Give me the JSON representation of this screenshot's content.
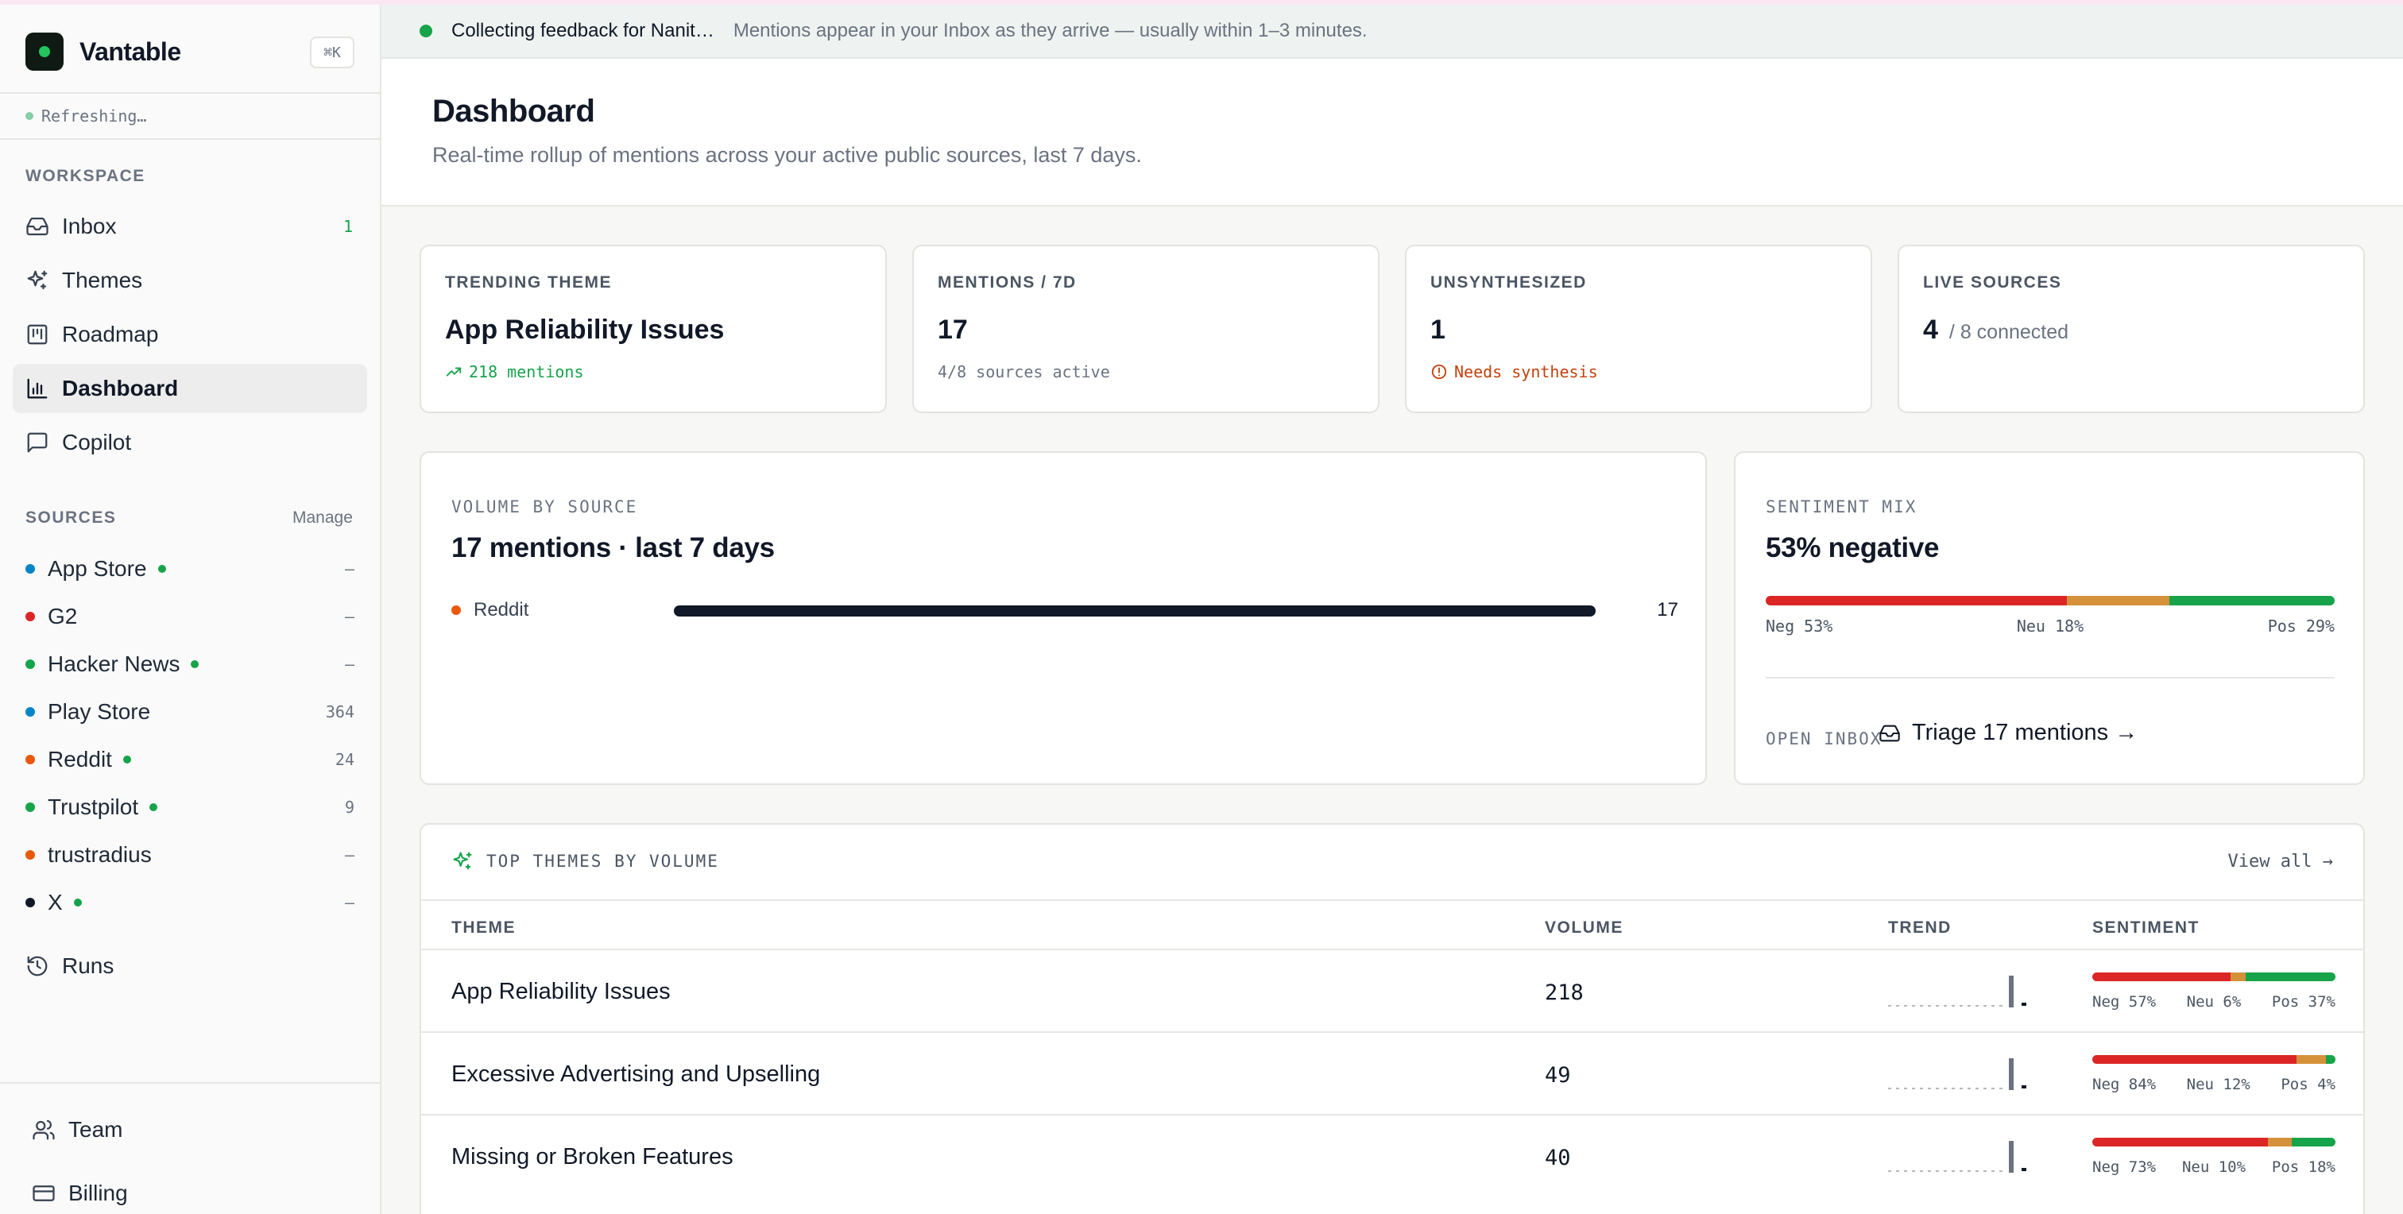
{
  "app": {
    "name": "Vantable",
    "shortcut": "⌘K",
    "status": "Refreshing…"
  },
  "sidebar": {
    "workspace_label": "WORKSPACE",
    "nav": [
      {
        "label": "Inbox",
        "icon": "inbox-icon",
        "badge": "1"
      },
      {
        "label": "Themes",
        "icon": "sparkles-icon",
        "badge": ""
      },
      {
        "label": "Roadmap",
        "icon": "roadmap-icon",
        "badge": ""
      },
      {
        "label": "Dashboard",
        "icon": "bar-chart-icon",
        "badge": "",
        "active": true
      },
      {
        "label": "Copilot",
        "icon": "chat-icon",
        "badge": ""
      }
    ],
    "sources_label": "SOURCES",
    "manage_label": "Manage",
    "sources": [
      {
        "name": "App Store",
        "color": "#0284c7",
        "live": true,
        "count": "–"
      },
      {
        "name": "G2",
        "color": "#dc2626",
        "live": false,
        "count": "–"
      },
      {
        "name": "Hacker News",
        "color": "#16a34a",
        "live": true,
        "count": "–"
      },
      {
        "name": "Play Store",
        "color": "#0284c7",
        "live": false,
        "count": "364"
      },
      {
        "name": "Reddit",
        "color": "#ea580c",
        "live": true,
        "count": "24"
      },
      {
        "name": "Trustpilot",
        "color": "#16a34a",
        "live": true,
        "count": "9"
      },
      {
        "name": "trustradius",
        "color": "#ea580c",
        "live": false,
        "count": "–"
      },
      {
        "name": "X",
        "color": "#111827",
        "live": true,
        "count": "–"
      }
    ],
    "runs_label": "Runs",
    "team_label": "Team",
    "billing_label": "Billing"
  },
  "banner": {
    "title": "Collecting feedback for Nanit…",
    "subtitle": "Mentions appear in your Inbox as they arrive — usually within 1–3 minutes."
  },
  "header": {
    "title": "Dashboard",
    "subtitle": "Real-time rollup of mentions across your active public sources, last 7 days."
  },
  "kpis": {
    "trending": {
      "label": "TRENDING THEME",
      "value": "App Reliability Issues",
      "sub": "218 mentions"
    },
    "mentions": {
      "label": "MENTIONS / 7D",
      "value": "17",
      "sub": "4/8 sources active"
    },
    "unsynth": {
      "label": "UNSYNTHESIZED",
      "value": "1",
      "sub": "Needs synthesis"
    },
    "live": {
      "label": "LIVE SOURCES",
      "value": "4",
      "suffix": "/ 8 connected"
    }
  },
  "volume": {
    "label": "VOLUME BY SOURCE",
    "title": "17 mentions · last 7 days",
    "rows": [
      {
        "name": "Reddit",
        "color": "#ea580c",
        "value": 17,
        "max": 17,
        "value_label": "17"
      }
    ]
  },
  "sentiment": {
    "label": "SENTIMENT MIX",
    "title": "53% negative",
    "neg": 53,
    "neu": 18,
    "pos": 29,
    "neg_label": "Neg 53%",
    "neu_label": "Neu 18%",
    "pos_label": "Pos 29%",
    "open_label": "OPEN INBOX",
    "triage_label": "Triage 17 mentions →"
  },
  "themes": {
    "label": "TOP THEMES BY VOLUME",
    "view_all": "View all →",
    "columns": {
      "theme": "THEME",
      "volume": "VOLUME",
      "trend": "TREND",
      "sentiment": "SENTIMENT"
    },
    "rows": [
      {
        "name": "App Reliability Issues",
        "volume": "218",
        "neg": 57,
        "neu": 6,
        "pos": 37,
        "neg_label": "Neg 57%",
        "neu_label": "Neu 6%",
        "pos_label": "Pos 37%"
      },
      {
        "name": "Excessive Advertising and Upselling",
        "volume": "49",
        "neg": 84,
        "neu": 12,
        "pos": 4,
        "neg_label": "Neg 84%",
        "neu_label": "Neu 12%",
        "pos_label": "Pos 4%"
      },
      {
        "name": "Missing or Broken Features",
        "volume": "40",
        "neg": 73,
        "neu": 10,
        "pos": 18,
        "neg_label": "Neg 73%",
        "neu_label": "Neu 10%",
        "pos_label": "Pos 18%"
      }
    ]
  },
  "colors": {
    "negative": "#dc2626",
    "neutral": "#d4913a",
    "positive": "#16a34a",
    "accent": "#16a34a"
  }
}
